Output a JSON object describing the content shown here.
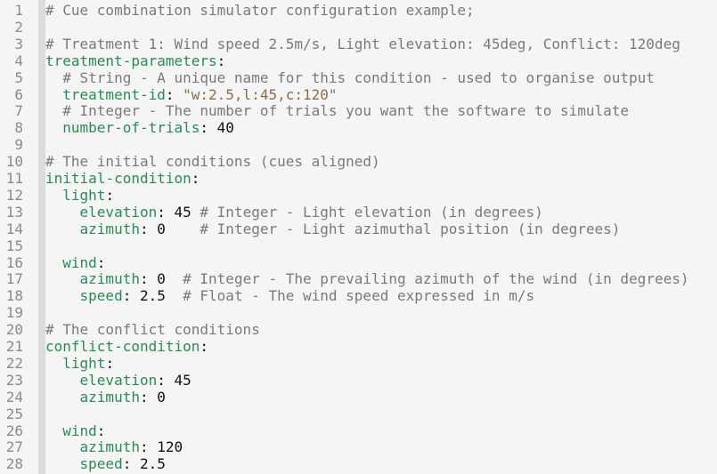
{
  "editor": {
    "colors": {
      "comment": "#7a7a7a",
      "key": "#2a8a57",
      "string": "#8a6d4b",
      "number": "#111111",
      "gutter": "#dcdcdc",
      "background": "#f5f5f5"
    },
    "lines": [
      [
        [
          "comment",
          "# Cue combination simulator configuration example;"
        ]
      ],
      [],
      [
        [
          "comment",
          "# Treatment 1: Wind speed 2.5m/s, Light elevation: 45deg, Conflict: 120deg"
        ]
      ],
      [
        [
          "key",
          "treatment-parameters"
        ],
        [
          "punct",
          ":"
        ]
      ],
      [
        [
          "plain",
          "  "
        ],
        [
          "comment",
          "# String - A unique name for this condition - used to organise output"
        ]
      ],
      [
        [
          "plain",
          "  "
        ],
        [
          "key",
          "treatment-id"
        ],
        [
          "punct",
          ": "
        ],
        [
          "str",
          "\"w:2.5,l:45,c:120\""
        ]
      ],
      [
        [
          "plain",
          "  "
        ],
        [
          "comment",
          "# Integer - The number of trials you want the software to simulate"
        ]
      ],
      [
        [
          "plain",
          "  "
        ],
        [
          "key",
          "number-of-trials"
        ],
        [
          "punct",
          ": "
        ],
        [
          "num",
          "40"
        ]
      ],
      [],
      [
        [
          "comment",
          "# The initial conditions (cues aligned)"
        ]
      ],
      [
        [
          "key",
          "initial-condition"
        ],
        [
          "punct",
          ":"
        ]
      ],
      [
        [
          "plain",
          "  "
        ],
        [
          "key",
          "light"
        ],
        [
          "punct",
          ":"
        ]
      ],
      [
        [
          "plain",
          "    "
        ],
        [
          "key",
          "elevation"
        ],
        [
          "punct",
          ": "
        ],
        [
          "num",
          "45"
        ],
        [
          "plain",
          " "
        ],
        [
          "comment",
          "# Integer - Light elevation (in degrees)"
        ]
      ],
      [
        [
          "plain",
          "    "
        ],
        [
          "key",
          "azimuth"
        ],
        [
          "punct",
          ": "
        ],
        [
          "num",
          "0"
        ],
        [
          "plain",
          "    "
        ],
        [
          "comment",
          "# Integer - Light azimuthal position (in degrees)"
        ]
      ],
      [],
      [
        [
          "plain",
          "  "
        ],
        [
          "key",
          "wind"
        ],
        [
          "punct",
          ":"
        ]
      ],
      [
        [
          "plain",
          "    "
        ],
        [
          "key",
          "azimuth"
        ],
        [
          "punct",
          ": "
        ],
        [
          "num",
          "0"
        ],
        [
          "plain",
          "  "
        ],
        [
          "comment",
          "# Integer - The prevailing azimuth of the wind (in degrees)"
        ]
      ],
      [
        [
          "plain",
          "    "
        ],
        [
          "key",
          "speed"
        ],
        [
          "punct",
          ": "
        ],
        [
          "num",
          "2.5"
        ],
        [
          "plain",
          "  "
        ],
        [
          "comment",
          "# Float - The wind speed expressed in m/s"
        ]
      ],
      [],
      [
        [
          "comment",
          "# The conflict conditions"
        ]
      ],
      [
        [
          "key",
          "conflict-condition"
        ],
        [
          "punct",
          ":"
        ]
      ],
      [
        [
          "plain",
          "  "
        ],
        [
          "key",
          "light"
        ],
        [
          "punct",
          ":"
        ]
      ],
      [
        [
          "plain",
          "    "
        ],
        [
          "key",
          "elevation"
        ],
        [
          "punct",
          ": "
        ],
        [
          "num",
          "45"
        ]
      ],
      [
        [
          "plain",
          "    "
        ],
        [
          "key",
          "azimuth"
        ],
        [
          "punct",
          ": "
        ],
        [
          "num",
          "0"
        ]
      ],
      [],
      [
        [
          "plain",
          "  "
        ],
        [
          "key",
          "wind"
        ],
        [
          "punct",
          ":"
        ]
      ],
      [
        [
          "plain",
          "    "
        ],
        [
          "key",
          "azimuth"
        ],
        [
          "punct",
          ": "
        ],
        [
          "num",
          "120"
        ]
      ],
      [
        [
          "plain",
          "    "
        ],
        [
          "key",
          "speed"
        ],
        [
          "punct",
          ": "
        ],
        [
          "num",
          "2.5"
        ]
      ]
    ],
    "line_numbers": [
      "1",
      "2",
      "3",
      "4",
      "5",
      "6",
      "7",
      "8",
      "9",
      "10",
      "11",
      "12",
      "13",
      "14",
      "15",
      "16",
      "17",
      "18",
      "19",
      "20",
      "21",
      "22",
      "23",
      "24",
      "25",
      "26",
      "27",
      "28"
    ]
  }
}
